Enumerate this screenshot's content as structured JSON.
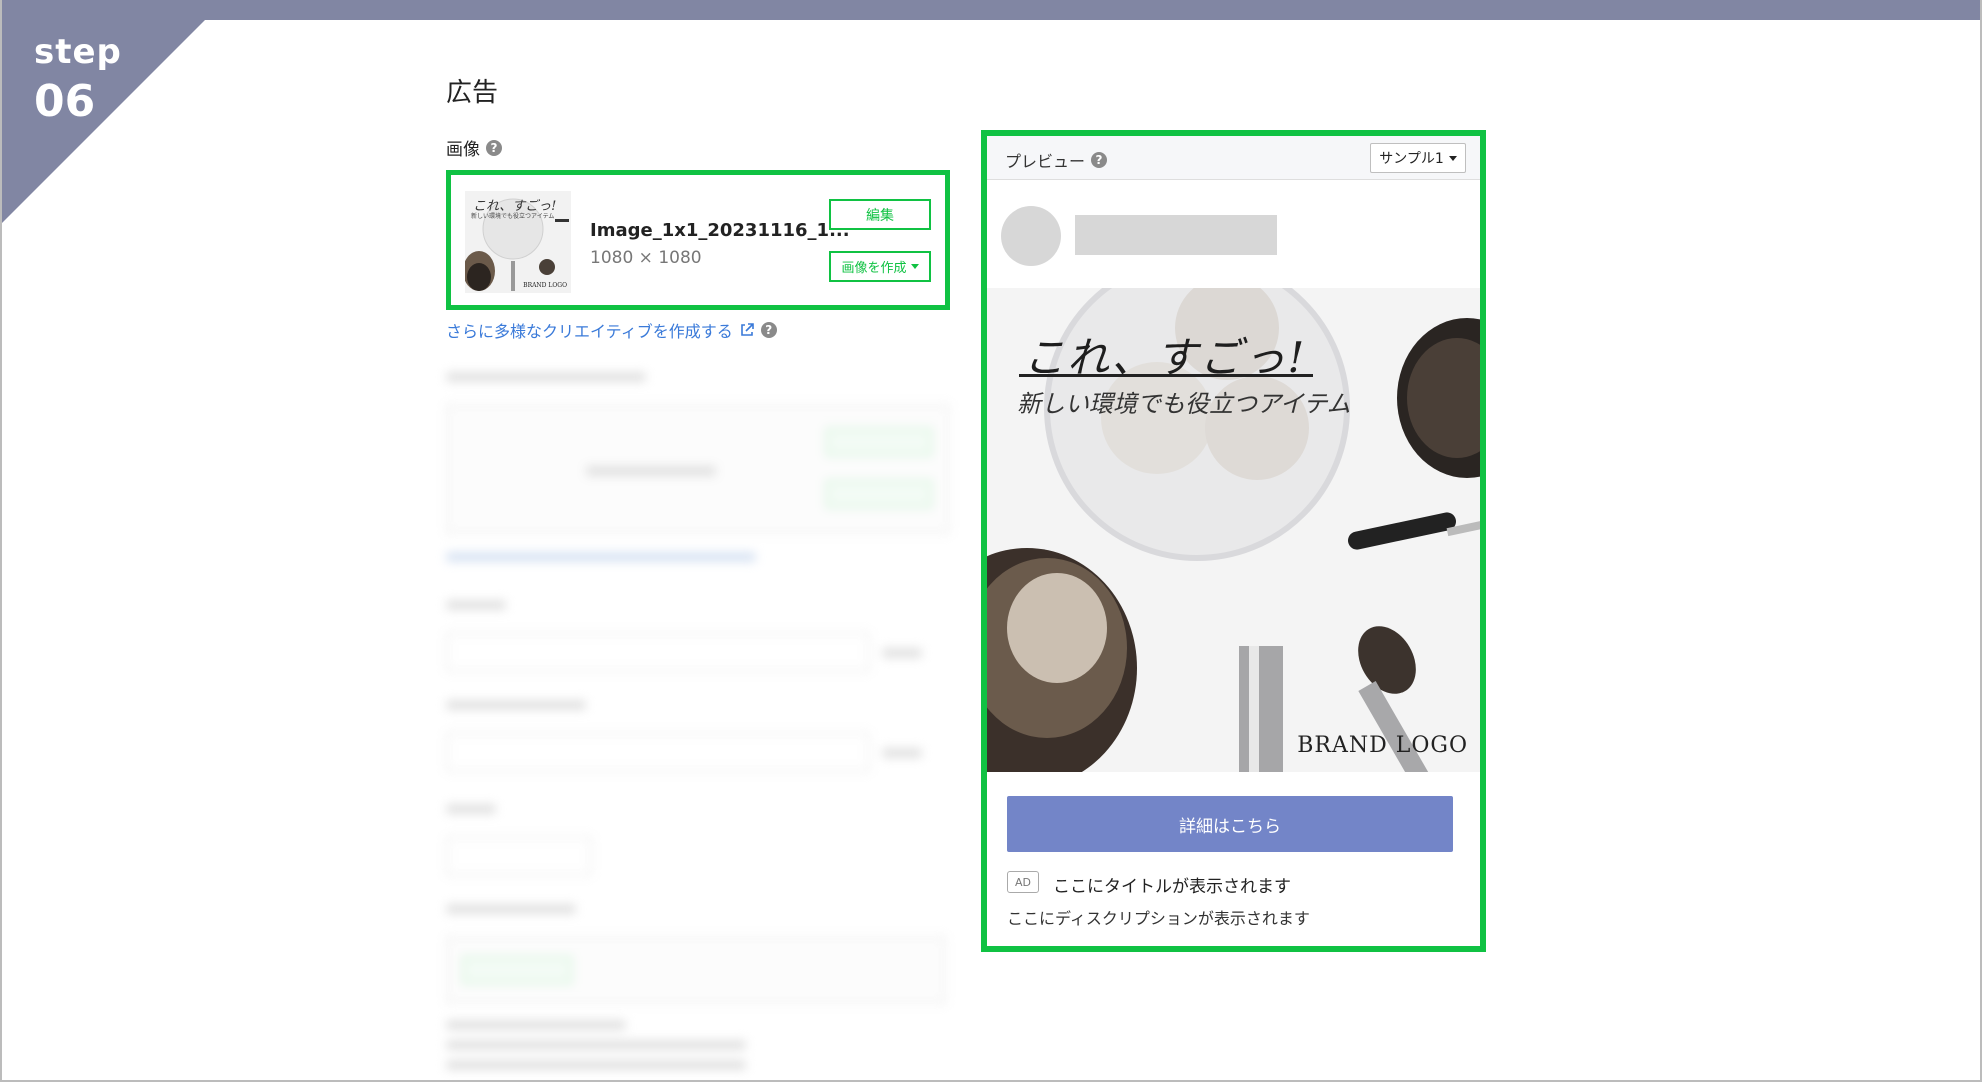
{
  "step": {
    "word": "step",
    "number": "06"
  },
  "section": {
    "title": "広告"
  },
  "image_field": {
    "label": "画像",
    "file_name": "Image_1x1_20231116_1...",
    "dimensions": "1080 × 1080",
    "edit_label": "編集",
    "create_label": "画像を作成",
    "thumb_headline": "これ、すごっ!",
    "thumb_sub": "新しい環境でも役立つアイテム",
    "thumb_logo": "BRAND LOGO"
  },
  "more_link": {
    "label": "さらに多様なクリエイティブを作成する"
  },
  "preview": {
    "title": "プレビュー",
    "sample_select": "サンプル1",
    "headline": "これ、すごっ!",
    "subline": "新しい環境でも役立つアイテム",
    "brand_logo": "BRAND LOGO",
    "cta_label": "詳細はこちら",
    "ad_badge": "AD",
    "ad_title": "ここにタイトルが表示されます",
    "ad_description": "ここにディスクリプションが表示されます"
  },
  "colors": {
    "highlight": "#10c243",
    "step_badge": "#8186a3",
    "cta": "#7385c8",
    "link": "#3a7ad9"
  },
  "icons": {
    "help": "question-circle-icon",
    "external": "external-link-icon",
    "dropdown": "caret-down-icon"
  }
}
